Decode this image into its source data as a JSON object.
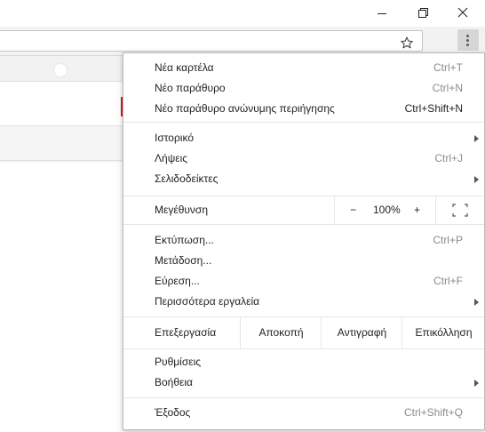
{
  "window": {
    "minimize_icon": "minimize-icon",
    "maximize_icon": "restore-icon",
    "close_icon": "close-icon"
  },
  "toolbar": {
    "bookmark_icon": "star-icon",
    "menu_icon": "more-vert-icon"
  },
  "menu": {
    "new_tab": {
      "label": "Νέα καρτέλα",
      "shortcut": "Ctrl+T"
    },
    "new_window": {
      "label": "Νέο παράθυρο",
      "shortcut": "Ctrl+N"
    },
    "incognito": {
      "label": "Νέο παράθυρο ανώνυμης περιήγησης",
      "shortcut": "Ctrl+Shift+N"
    },
    "history": {
      "label": "Ιστορικό"
    },
    "downloads": {
      "label": "Λήψεις",
      "shortcut": "Ctrl+J"
    },
    "bookmarks": {
      "label": "Σελιδοδείκτες"
    },
    "zoom": {
      "label": "Μεγέθυνση",
      "minus": "−",
      "value": "100%",
      "plus": "+",
      "fullscreen_icon": "fullscreen-icon"
    },
    "print": {
      "label": "Εκτύπωση...",
      "shortcut": "Ctrl+P"
    },
    "cast": {
      "label": "Μετάδοση..."
    },
    "find": {
      "label": "Εύρεση...",
      "shortcut": "Ctrl+F"
    },
    "more_tools": {
      "label": "Περισσότερα εργαλεία"
    },
    "edit": {
      "label": "Επεξεργασία",
      "cut": "Αποκοπή",
      "copy": "Αντιγραφή",
      "paste": "Επικόλληση"
    },
    "settings": {
      "label": "Ρυθμίσεις"
    },
    "help": {
      "label": "Βοήθεια"
    },
    "exit": {
      "label": "Έξοδος",
      "shortcut": "Ctrl+Shift+Q"
    }
  },
  "colors": {
    "highlight_border": "#e0141e",
    "menu_background": "#ffffff",
    "toolbar_background": "#f2f2f2"
  }
}
